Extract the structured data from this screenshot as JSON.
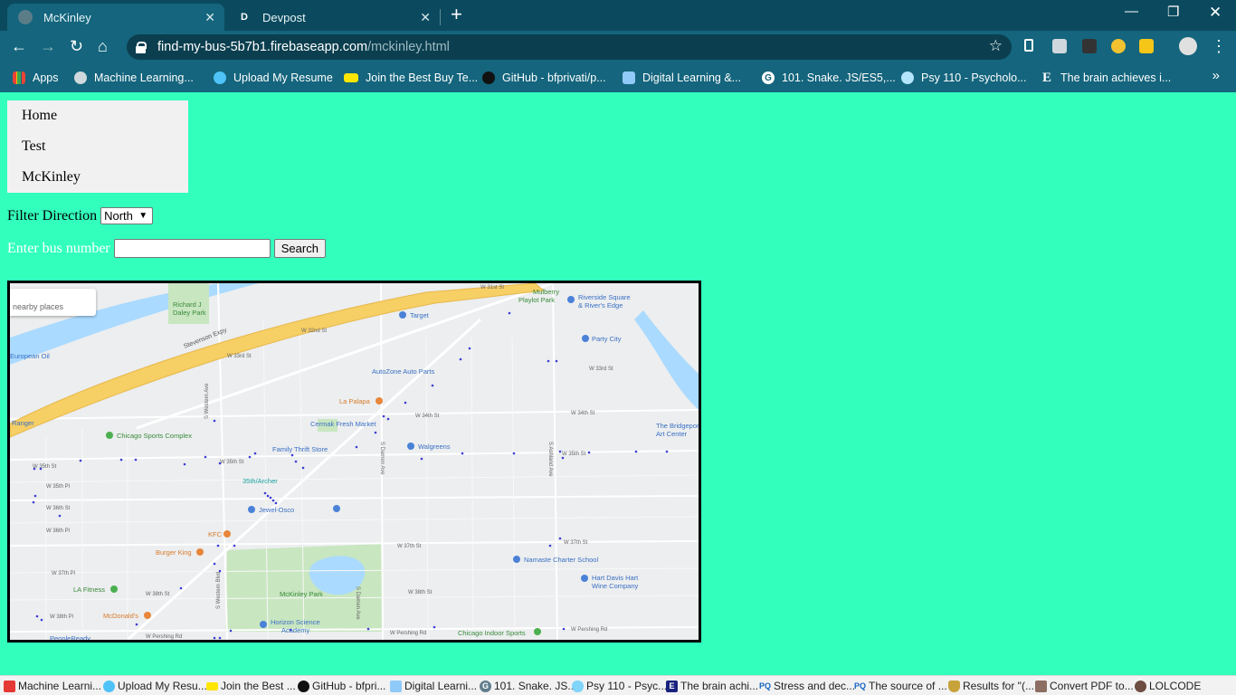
{
  "browser": {
    "tabs": [
      {
        "title": "McKinley",
        "active": true,
        "icon": "globe-icon"
      },
      {
        "title": "Devpost",
        "active": false,
        "icon": "devpost-icon",
        "icon_letter": "D"
      }
    ],
    "url": {
      "host": "find-my-bus-5b7b1.firebaseapp.com",
      "path": "/mckinley.html"
    },
    "bookmarks": [
      {
        "label": "Apps",
        "icon": "apps-grid-icon"
      },
      {
        "label": "Machine Learning...",
        "icon": "globe-icon"
      },
      {
        "label": "Upload My Resume",
        "icon": "database-icon"
      },
      {
        "label": "Join the Best Buy Te...",
        "icon": "tag-icon"
      },
      {
        "label": "GitHub - bfprivati/p...",
        "icon": "github-icon"
      },
      {
        "label": "Digital Learning &...",
        "icon": "digital-learning-icon"
      },
      {
        "label": "101. Snake. JS/ES5,...",
        "icon": "g-icon",
        "icon_letter": "G"
      },
      {
        "label": "Psy 110 - Psycholo...",
        "icon": "cloud-icon"
      },
      {
        "label": "The brain achieves i...",
        "icon": "e-icon",
        "icon_letter": "E"
      }
    ],
    "more_bookmarks": "»"
  },
  "page": {
    "nav": {
      "items": [
        {
          "label": "Home"
        },
        {
          "label": "Test"
        },
        {
          "label": "McKinley"
        }
      ]
    },
    "filter": {
      "label": "Filter Direction",
      "selected": "North"
    },
    "bus_search": {
      "label": "Enter bus number",
      "value": "",
      "button": "Search"
    },
    "map": {
      "search_placeholder": "nearby places",
      "streets": [
        "Stevenson Expy",
        "W 35th St",
        "W 35th Pl",
        "W 36th St",
        "W 37th St",
        "W 38th St",
        "W 33rd St",
        "W 34th St",
        "W 32nd St",
        "S Western Ave",
        "S Western Blvd",
        "S Ashland Ave",
        "S Damen Ave",
        "W Pershing Rd",
        "W 31st St",
        "W 36th Pl",
        "W 37th Pl",
        "W 38th Pl"
      ],
      "places": [
        "Richard J Daley Park",
        "Target",
        "Mulberry Playlot Park",
        "Riverside Square & River's Edge",
        "Party City",
        "AutoZone Auto Parts",
        "La Palapa",
        "Cermak Fresh Market",
        "Chicago Sports Complex",
        "Family Thrift Store",
        "Walgreens",
        "The Bridgeport Art Center",
        "35th/Archer",
        "Jewel-Osco",
        "KFC",
        "Burger King",
        "Namaste Charter School",
        "Hart Davis Hart Wine Company",
        "McKinley Park",
        "LA Fitness",
        "McDonald's",
        "Horizon Science Academy",
        "Chicago Indoor Sports",
        "Ranger",
        "European Oil",
        "PeopleReady"
      ],
      "colors": {
        "land": "#eceeef",
        "water": "#aadaff",
        "park": "#c8e6c0",
        "highway": "#f6cf65",
        "bus_marker": "#3d3dd6"
      }
    }
  },
  "bottom_bookmarks": [
    {
      "label": "Machine Learni...",
      "icon": "ml-icon"
    },
    {
      "label": "Upload My Resu...",
      "icon": "database-icon"
    },
    {
      "label": "Join the Best ...",
      "icon": "tag-icon"
    },
    {
      "label": "GitHub - bfpri...",
      "icon": "github-icon"
    },
    {
      "label": "Digital Learni...",
      "icon": "digital-learning-icon"
    },
    {
      "label": "101. Snake. JS...",
      "icon": "g-icon",
      "icon_letter": "G"
    },
    {
      "label": "Psy 110 - Psyc...",
      "icon": "cloud-icon"
    },
    {
      "label": "The brain achi...",
      "icon": "e-icon",
      "icon_letter": "E"
    },
    {
      "label": "Stress and dec...",
      "icon": "pq-icon",
      "icon_letter": "PQ"
    },
    {
      "label": "The source of ...",
      "icon": "pq-icon",
      "icon_letter": "PQ"
    },
    {
      "label": "Results for \"(...",
      "icon": "shield-icon"
    },
    {
      "label": "Convert PDF to...",
      "icon": "pdf-icon"
    },
    {
      "label": "LOLCODE",
      "icon": "lolcode-icon"
    }
  ]
}
